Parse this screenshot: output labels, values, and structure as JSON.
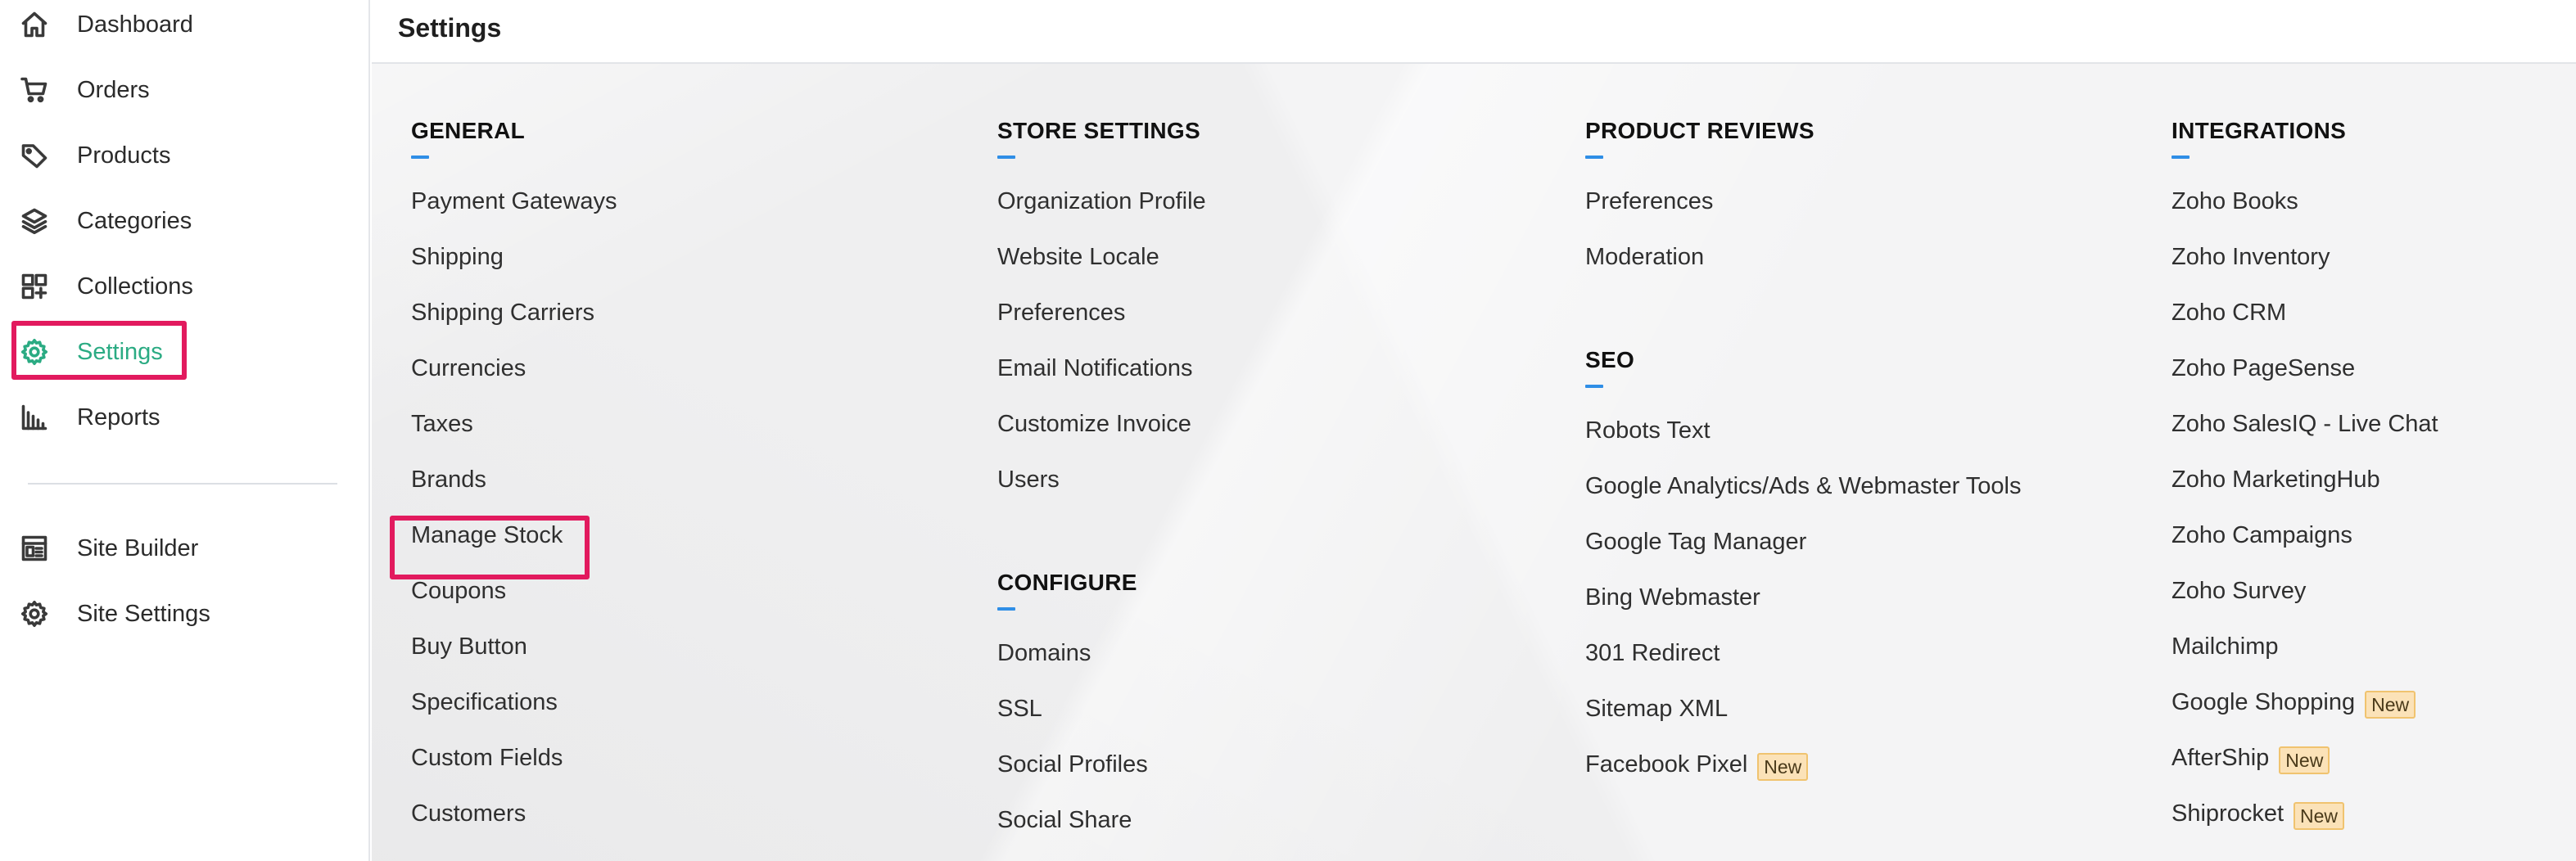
{
  "sidebar": {
    "items": [
      {
        "id": "dashboard",
        "label": "Dashboard",
        "icon": "home-icon"
      },
      {
        "id": "orders",
        "label": "Orders",
        "icon": "cart-icon"
      },
      {
        "id": "products",
        "label": "Products",
        "icon": "tag-icon"
      },
      {
        "id": "categories",
        "label": "Categories",
        "icon": "layers-icon"
      },
      {
        "id": "collections",
        "label": "Collections",
        "icon": "collections-icon"
      },
      {
        "id": "settings",
        "label": "Settings",
        "icon": "gear-icon",
        "active": true
      },
      {
        "id": "reports",
        "label": "Reports",
        "icon": "bar-chart-icon"
      }
    ],
    "secondary_items": [
      {
        "id": "site-builder",
        "label": "Site Builder",
        "icon": "site-builder-icon"
      },
      {
        "id": "site-settings",
        "label": "Site Settings",
        "icon": "gear-icon"
      }
    ]
  },
  "header": {
    "title": "Settings"
  },
  "columns": [
    {
      "sections": [
        {
          "heading": "GENERAL",
          "links": [
            {
              "label": "Payment Gateways"
            },
            {
              "label": "Shipping"
            },
            {
              "label": "Shipping Carriers"
            },
            {
              "label": "Currencies"
            },
            {
              "label": "Taxes"
            },
            {
              "label": "Brands"
            },
            {
              "label": "Manage Stock",
              "highlighted": true
            },
            {
              "label": "Coupons"
            },
            {
              "label": "Buy Button"
            },
            {
              "label": "Specifications"
            },
            {
              "label": "Custom Fields"
            },
            {
              "label": "Customers"
            }
          ]
        }
      ]
    },
    {
      "sections": [
        {
          "heading": "STORE SETTINGS",
          "links": [
            {
              "label": "Organization Profile"
            },
            {
              "label": "Website Locale"
            },
            {
              "label": "Preferences"
            },
            {
              "label": "Email Notifications"
            },
            {
              "label": "Customize Invoice"
            },
            {
              "label": "Users"
            }
          ]
        },
        {
          "heading": "CONFIGURE",
          "links": [
            {
              "label": "Domains"
            },
            {
              "label": "SSL"
            },
            {
              "label": "Social Profiles"
            },
            {
              "label": "Social Share"
            }
          ]
        }
      ]
    },
    {
      "sections": [
        {
          "heading": "PRODUCT REVIEWS",
          "links": [
            {
              "label": "Preferences"
            },
            {
              "label": "Moderation"
            }
          ]
        },
        {
          "heading": "SEO",
          "links": [
            {
              "label": "Robots Text"
            },
            {
              "label": "Google Analytics/Ads & Webmaster Tools"
            },
            {
              "label": "Google Tag Manager"
            },
            {
              "label": "Bing Webmaster"
            },
            {
              "label": "301 Redirect"
            },
            {
              "label": "Sitemap XML"
            },
            {
              "label": "Facebook Pixel",
              "badge": "New"
            }
          ]
        }
      ]
    },
    {
      "sections": [
        {
          "heading": "INTEGRATIONS",
          "links": [
            {
              "label": "Zoho Books"
            },
            {
              "label": "Zoho Inventory"
            },
            {
              "label": "Zoho CRM"
            },
            {
              "label": "Zoho PageSense"
            },
            {
              "label": "Zoho SalesIQ - Live Chat"
            },
            {
              "label": "Zoho MarketingHub"
            },
            {
              "label": "Zoho Campaigns"
            },
            {
              "label": "Zoho Survey"
            },
            {
              "label": "Mailchimp"
            },
            {
              "label": "Google Shopping",
              "badge": "New"
            },
            {
              "label": "AfterShip",
              "badge": "New"
            },
            {
              "label": "Shiprocket",
              "badge": "New"
            }
          ]
        }
      ]
    }
  ],
  "colors": {
    "accent": "#2bab83",
    "highlight": "#e21a5e",
    "underline": "#2f8ee6",
    "badge_bg": "#fbe2b8"
  }
}
